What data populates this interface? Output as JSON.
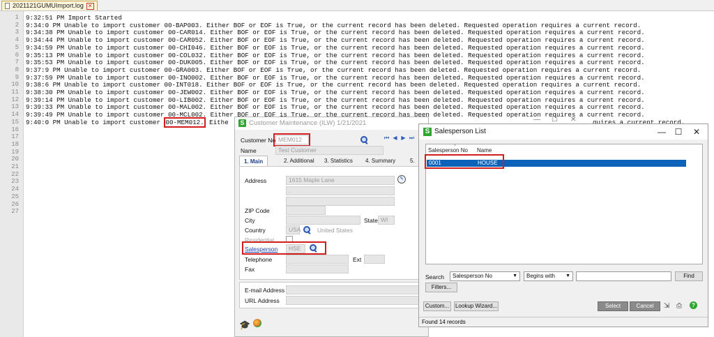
{
  "editor": {
    "tab_title": "2021121GUMUImport.log",
    "line_numbers": [
      "1",
      "2",
      "3",
      "4",
      "5",
      "6",
      "7",
      "8",
      "9",
      "10",
      "11",
      "12",
      "13",
      "14",
      "15",
      "16",
      "17",
      "18",
      "19",
      "20",
      "21",
      "22",
      "23",
      "24",
      "25",
      "26",
      "27"
    ],
    "lines": [
      "9:32:51 PM Import Started",
      "9:34:0 PM Unable to import customer 00-BAP003. Either BOF or EOF is True, or the current record has been deleted. Requested operation requires a current record.",
      "9:34:38 PM Unable to import customer 00-CAR014. Either BOF or EOF is True, or the current record has been deleted. Requested operation requires a current record.",
      "9:34:44 PM Unable to import customer 00-CAR052. Either BOF or EOF is True, or the current record has been deleted. Requested operation requires a current record.",
      "9:34:59 PM Unable to import customer 00-CHI046. Either BOF or EOF is True, or the current record has been deleted. Requested operation requires a current record.",
      "9:35:13 PM Unable to import customer 00-COL032. Either BOF or EOF is True, or the current record has been deleted. Requested operation requires a current record.",
      "9:35:53 PM Unable to import customer 00-DUK005. Either BOF or EOF is True, or the current record has been deleted. Requested operation requires a current record.",
      "9:37:9 PM Unable to import customer 00-GRA003. Either BOF or EOF is True, or the current record has been deleted. Requested operation requires a current record.",
      "9:37:59 PM Unable to import customer 00-INO002. Either BOF or EOF is True, or the current record has been deleted. Requested operation requires a current record.",
      "9:38:6 PM Unable to import customer 00-INT018. Either BOF or EOF is True, or the current record has been deleted. Requested operation requires a current record.",
      "9:38:30 PM Unable to import customer 00-JEW002. Either BOF or EOF is True, or the current record has been deleted. Requested operation requires a current record.",
      "9:39:14 PM Unable to import customer 00-LIB002. Either BOF or EOF is True, or the current record has been deleted. Requested operation requires a current record.",
      "9:39:33 PM Unable to import customer 00-MAL002. Either BOF or EOF is True, or the current record has been deleted. Requested operation requires a current record.",
      "9:39:49 PM Unable to import customer 00-MCL002. Either BOF or EOF is True, or the current record has been deleted. Requested operation requires a current record."
    ],
    "line15_prefix": "9:40:0 PM Unable to import customer ",
    "line15_highlight": "00-MEM012.",
    "line15_rest": " Eithe",
    "line15_tail": "quires a current record."
  },
  "customer_maintenance": {
    "title": "Customer Maintenance (ILW) 1/21/2021",
    "customer_no_label": "Customer No.",
    "customer_no": "MEM012",
    "name_label": "Name",
    "name": "Test Customer",
    "tabs": [
      "1. Main",
      "2. Additional",
      "3. Statistics",
      "4. Summary",
      "5. "
    ],
    "address_label": "Address",
    "address_line1": "1615 Maple Lane",
    "address_line2": ".",
    "zip_label": "ZIP Code",
    "city_label": "City",
    "state_label": "State",
    "state": "WI",
    "country_label": "Country",
    "country_code": "USA",
    "country_name": "United States",
    "residential_label": "Residential",
    "salesperson_label": "Salesperson",
    "salesperson": "HSE",
    "telephone_label": "Telephone",
    "ext_label": "Ext",
    "fax_label": "Fax",
    "email_label": "E-mail Address",
    "url_label": "URL Address"
  },
  "salesperson_list": {
    "title": "Salesperson List",
    "columns": [
      "Salesperson No",
      "Name"
    ],
    "rows": [
      {
        "no": "0001",
        "name": "HOUSE"
      }
    ],
    "search_label": "Search",
    "search_field": "Salesperson No",
    "search_operator": "Begins with",
    "search_value": "",
    "find_button": "Find",
    "filters_button": "Filters...",
    "custom_button": "Custom...",
    "lookup_wizard_button": "Lookup Wizard...",
    "select_button": "Select",
    "cancel_button": "Cancel",
    "status": "Found 14 records"
  },
  "colors": {
    "highlight_red": "#d11d1d",
    "selection_blue": "#0b62b8",
    "sage_green": "#2ea72e"
  }
}
